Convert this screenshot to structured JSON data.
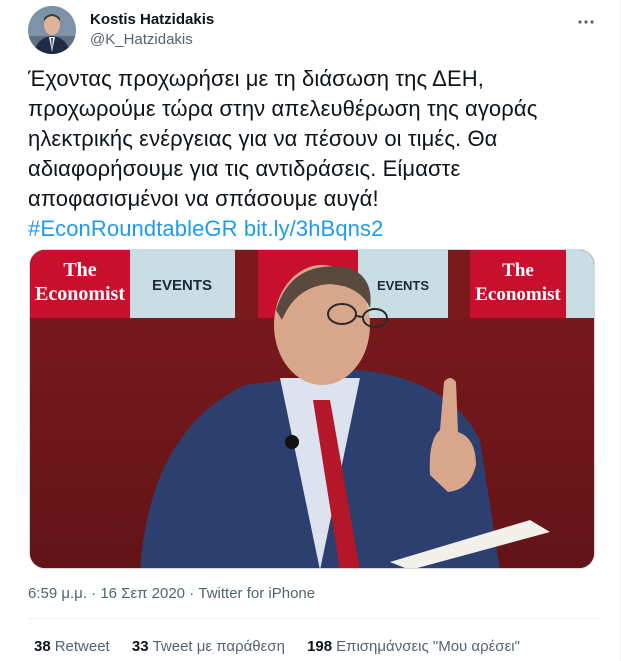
{
  "author": {
    "display_name": "Kostis Hatzidakis",
    "handle": "@K_Hatzidakis",
    "avatar_icon": "profile-photo-avatar"
  },
  "more_icon": "more-horizontal-icon",
  "tweet": {
    "lines": [
      "Έχοντας προχωρήσει με τη διάσωση της ΔΕΗ,",
      "προχωρούμε τώρα στην απελευθέρωση της αγοράς",
      "ηλεκτρικής ενέργειας για να πέσουν οι τιμές. Θα",
      "αδιαφορήσουμε για τις αντιδράσεις. Είμαστε",
      "αποφασισμένοι να σπάσουμε αυγά!"
    ],
    "hashtag": "#EconRoundtableGR",
    "link": "bit.ly/3hBqns2"
  },
  "media": {
    "banner_text_1": "The",
    "banner_text_2": "Economist",
    "banner_events": "EVENTS"
  },
  "meta": {
    "time": "6:59 μ.μ.",
    "separator": "·",
    "date": "16 Σεπ 2020",
    "source": "Twitter for iPhone"
  },
  "stats": {
    "retweets_count": "38",
    "retweets_label": "Retweet",
    "quotes_count": "33",
    "quotes_label": "Tweet με παράθεση",
    "likes_count": "198",
    "likes_label": "Επισημάνσεις \"Μου αρέσει\""
  },
  "colors": {
    "link": "#1d9bf0",
    "secondary_text": "#536471",
    "primary_text": "#0f1419",
    "economist_red": "#c8102e"
  }
}
